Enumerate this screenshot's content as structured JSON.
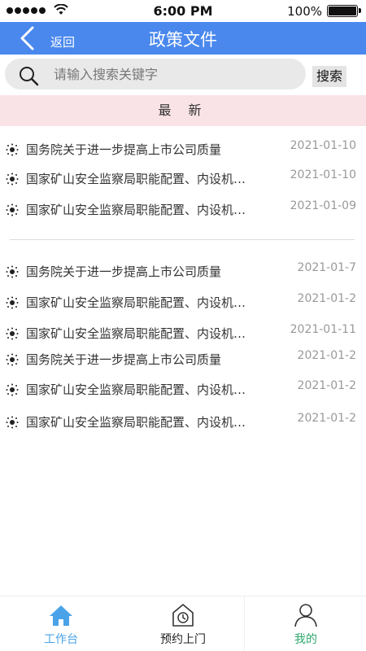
{
  "status_bar": {
    "time": "6:00 PM",
    "battery": "100%"
  },
  "header": {
    "back_label": "返回",
    "title": "政策文件"
  },
  "search": {
    "placeholder": "请输入搜索关键字",
    "button_label": "搜索"
  },
  "section": {
    "latest_label": "最 新"
  },
  "items": [
    {
      "title": "国务院关于进一步提高上市公司质量",
      "date": "2021-01-10"
    },
    {
      "title": "国家矿山安全监察局职能配置、内设机…",
      "date": "2021-01-10"
    },
    {
      "title": "国家矿山安全监察局职能配置、内设机…",
      "date": "2021-01-09"
    },
    {
      "title": "国务院关于进一步提高上市公司质量",
      "date": "2021-01-7"
    },
    {
      "title": "国家矿山安全监察局职能配置、内设机…",
      "date": "2021-01-2"
    },
    {
      "title": "国家矿山安全监察局职能配置、内设机…",
      "date": "2021-01-11"
    },
    {
      "title": "国务院关于进一步提高上市公司质量",
      "date": "2021-01-2"
    },
    {
      "title": "国家矿山安全监察局职能配置、内设机…",
      "date": "2021-01-2"
    },
    {
      "title": "国家矿山安全监察局职能配置、内设机…",
      "date": "2021-01-2"
    }
  ],
  "tabbar": {
    "tabs": [
      {
        "label": "工作台",
        "icon": "home-icon",
        "color": "#4aa3e8"
      },
      {
        "label": "预约上门",
        "icon": "clock-house-icon",
        "color": "#222222"
      },
      {
        "label": "我的",
        "icon": "person-icon",
        "color": "#2fa86d"
      }
    ]
  },
  "colors": {
    "header_bg": "#4a88ee",
    "latest_bg": "#f9e3e7",
    "date_text": "#999999"
  }
}
